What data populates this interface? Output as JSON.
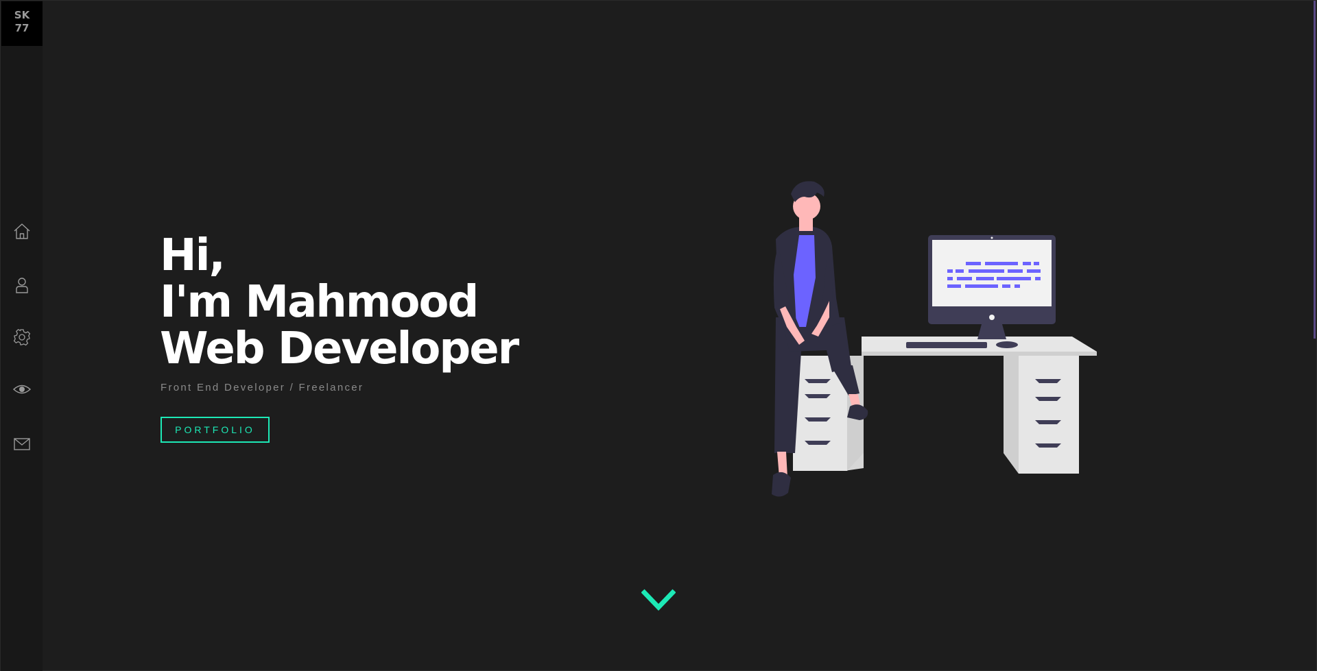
{
  "logo": {
    "line1": "SK",
    "line2": "77"
  },
  "nav": {
    "items": [
      {
        "icon": "home-icon"
      },
      {
        "icon": "user-icon"
      },
      {
        "icon": "gear-icon"
      },
      {
        "icon": "eye-icon"
      },
      {
        "icon": "mail-icon"
      }
    ]
  },
  "hero": {
    "line1": "Hi,",
    "line2": "I'm Mahmood",
    "line3": "Web Developer",
    "subtitle": "Front End Developer / Freelancer",
    "button_label": "PORTFOLIO"
  },
  "colors": {
    "background": "#1d1d1d",
    "sidebar": "#181818",
    "accent": "#1de9b6",
    "illustration_purple": "#6c63ff",
    "scrollbar": "#5a4a86"
  },
  "scroll_down_icon": "chevron-down-icon"
}
